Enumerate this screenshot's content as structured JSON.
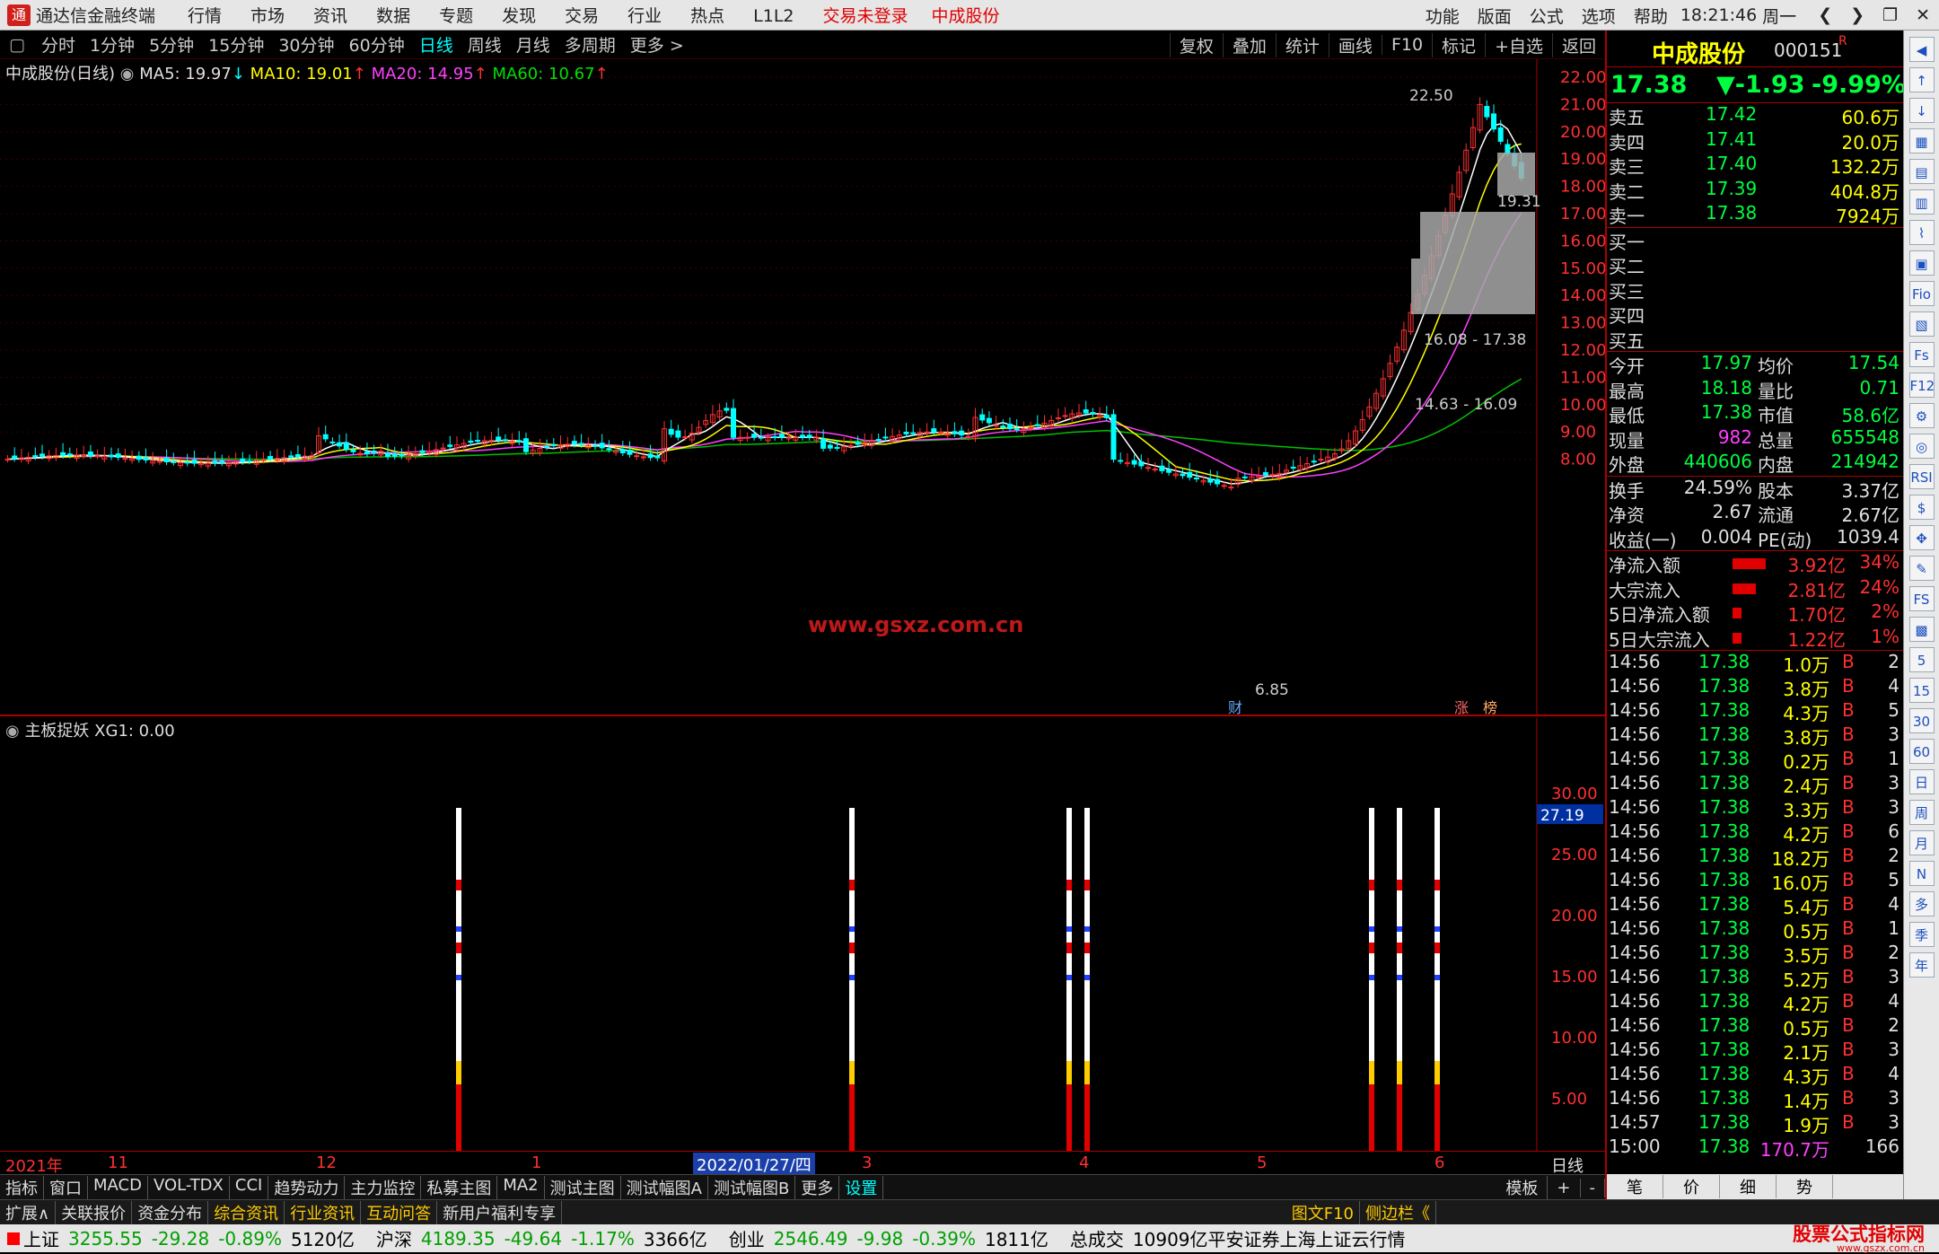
{
  "titlebar": {
    "app_name": "通达信金融终端",
    "menus": [
      "行情",
      "市场",
      "资讯",
      "数据",
      "专题",
      "发现",
      "交易",
      "行业",
      "热点",
      "L1L2"
    ],
    "trade_status": "交易未登录",
    "stock_name": "中成股份",
    "right_menus": [
      "功能",
      "版面",
      "公式",
      "选项",
      "帮助"
    ],
    "time": "18:21:46",
    "weekday": "周一"
  },
  "periods": [
    "分时",
    "1分钟",
    "5分钟",
    "15分钟",
    "30分钟",
    "60分钟",
    "日线",
    "周线",
    "月线",
    "多周期",
    "更多 >"
  ],
  "active_period": "日线",
  "chart_tools": [
    "复权",
    "叠加",
    "统计",
    "画线",
    "F10",
    "标记",
    "+自选",
    "返回"
  ],
  "main_chart": {
    "title": "中成股份(日线)",
    "ma5": "MA5: 19.97",
    "ma10": "MA10: 19.01",
    "ma20": "MA20: 14.95",
    "ma60": "MA60: 10.67",
    "high_label": "22.50",
    "low_label": "6.85",
    "last_label": "19.31",
    "gap1_label": "16.08 - 17.38",
    "gap2_label": "14.63 - 16.09",
    "watermark": "www.gsxz.com.cn",
    "badge_cai": "财",
    "badge_zhang": "涨",
    "badge_bang": "榜",
    "y_ticks": [
      "22.00",
      "21.00",
      "20.00",
      "19.00",
      "18.00",
      "17.00",
      "16.00",
      "15.00",
      "14.00",
      "13.00",
      "12.00",
      "11.00",
      "10.00",
      "9.00",
      "8.00"
    ]
  },
  "sub_chart": {
    "title": "主板捉妖 XG1: 0.00",
    "y_ticks": [
      "30.00",
      "25.00",
      "20.00",
      "15.00",
      "10.00",
      "5.00"
    ],
    "cursor_value": "27.19"
  },
  "x_axis": {
    "labels": [
      "2021年",
      "11",
      "12",
      "1",
      "2022/01/27/四",
      "3",
      "4",
      "5",
      "6"
    ],
    "period_label": "日线"
  },
  "tabs": [
    "指标",
    "窗口",
    "MACD",
    "VOL-TDX",
    "CCI",
    "趋势动力",
    "主力监控",
    "私募主图",
    "MA2",
    "测试主图",
    "测试幅图A",
    "测试幅图B",
    "更多",
    "设置"
  ],
  "tabs_right": [
    "模板",
    "+",
    "-"
  ],
  "links": [
    "扩展∧",
    "关联报价",
    "资金分布",
    "综合资讯",
    "行业资讯",
    "互动问答",
    "新用户福利专享"
  ],
  "links_right": [
    "图文F10",
    "侧边栏《",
    "笔",
    "价",
    "细",
    "势"
  ],
  "quote": {
    "name": "中成股份",
    "code": "000151",
    "flag": "R",
    "price": "17.38",
    "change": "▼-1.93",
    "change_pct": "-9.99%",
    "asks": [
      {
        "label": "卖五",
        "price": "17.42",
        "vol": "60.6万"
      },
      {
        "label": "卖四",
        "price": "17.41",
        "vol": "20.0万"
      },
      {
        "label": "卖三",
        "price": "17.40",
        "vol": "132.2万"
      },
      {
        "label": "卖二",
        "price": "17.39",
        "vol": "404.8万"
      },
      {
        "label": "卖一",
        "price": "17.38",
        "vol": "7924万"
      }
    ],
    "bids": [
      "买一",
      "买二",
      "买三",
      "买四",
      "买五"
    ],
    "stats": [
      {
        "k1": "今开",
        "v1": "17.97",
        "k2": "均价",
        "v2": "17.54"
      },
      {
        "k1": "最高",
        "v1": "18.18",
        "k2": "量比",
        "v2": "0.71"
      },
      {
        "k1": "最低",
        "v1": "17.38",
        "k2": "市值",
        "v2": "58.6亿"
      },
      {
        "k1": "现量",
        "v1": "982",
        "k2": "总量",
        "v2": "655548"
      },
      {
        "k1": "外盘",
        "v1": "440606",
        "k2": "内盘",
        "v2": "214942"
      }
    ],
    "stats2": [
      {
        "k1": "换手",
        "v1": "24.59%",
        "k2": "股本",
        "v2": "3.37亿"
      },
      {
        "k1": "净资",
        "v1": "2.67",
        "k2": "流通",
        "v2": "2.67亿"
      },
      {
        "k1": "收益(一)",
        "v1": "0.004",
        "k2": "PE(动)",
        "v2": "1039.4"
      }
    ],
    "flows": [
      {
        "label": "净流入额",
        "value": "3.92亿",
        "pct": "34%",
        "bar": 0.34
      },
      {
        "label": "大宗流入",
        "value": "2.81亿",
        "pct": "24%",
        "bar": 0.24
      },
      {
        "label": "5日净流入额",
        "value": "1.70亿",
        "pct": "2%",
        "bar": 0.02
      },
      {
        "label": "5日大宗流入",
        "value": "1.22亿",
        "pct": "1%",
        "bar": 0.01
      }
    ],
    "ticks": [
      {
        "t": "14:56",
        "p": "17.38",
        "v": "1.0万",
        "d": "B",
        "n": "2"
      },
      {
        "t": "14:56",
        "p": "17.38",
        "v": "3.8万",
        "d": "B",
        "n": "4"
      },
      {
        "t": "14:56",
        "p": "17.38",
        "v": "4.3万",
        "d": "B",
        "n": "5"
      },
      {
        "t": "14:56",
        "p": "17.38",
        "v": "3.8万",
        "d": "B",
        "n": "3"
      },
      {
        "t": "14:56",
        "p": "17.38",
        "v": "0.2万",
        "d": "B",
        "n": "1"
      },
      {
        "t": "14:56",
        "p": "17.38",
        "v": "2.4万",
        "d": "B",
        "n": "3"
      },
      {
        "t": "14:56",
        "p": "17.38",
        "v": "3.3万",
        "d": "B",
        "n": "3"
      },
      {
        "t": "14:56",
        "p": "17.38",
        "v": "4.2万",
        "d": "B",
        "n": "6"
      },
      {
        "t": "14:56",
        "p": "17.38",
        "v": "18.2万",
        "d": "B",
        "n": "2"
      },
      {
        "t": "14:56",
        "p": "17.38",
        "v": "16.0万",
        "d": "B",
        "n": "5"
      },
      {
        "t": "14:56",
        "p": "17.38",
        "v": "5.4万",
        "d": "B",
        "n": "4"
      },
      {
        "t": "14:56",
        "p": "17.38",
        "v": "0.5万",
        "d": "B",
        "n": "1"
      },
      {
        "t": "14:56",
        "p": "17.38",
        "v": "3.5万",
        "d": "B",
        "n": "2"
      },
      {
        "t": "14:56",
        "p": "17.38",
        "v": "5.2万",
        "d": "B",
        "n": "3"
      },
      {
        "t": "14:56",
        "p": "17.38",
        "v": "4.2万",
        "d": "B",
        "n": "4"
      },
      {
        "t": "14:56",
        "p": "17.38",
        "v": "0.5万",
        "d": "B",
        "n": "2"
      },
      {
        "t": "14:56",
        "p": "17.38",
        "v": "2.1万",
        "d": "B",
        "n": "3"
      },
      {
        "t": "14:56",
        "p": "17.38",
        "v": "4.3万",
        "d": "B",
        "n": "4"
      },
      {
        "t": "14:56",
        "p": "17.38",
        "v": "1.4万",
        "d": "B",
        "n": "3"
      },
      {
        "t": "14:57",
        "p": "17.38",
        "v": "1.9万",
        "d": "B",
        "n": "3"
      },
      {
        "t": "15:00",
        "p": "17.38",
        "v": "170.7万",
        "d": "",
        "n": "166"
      }
    ]
  },
  "side_icons": [
    "◀",
    "↑",
    "↓",
    "▦",
    "▤",
    "▥",
    "⌇",
    "▣",
    "Fio",
    "▧",
    "Fs",
    "F12",
    "⚙",
    "◎",
    "RSI",
    "$",
    "✥",
    "✎",
    "FS",
    "▩",
    "5",
    "15",
    "30",
    "60",
    "日",
    "周",
    "月",
    "N",
    "多",
    "季",
    "年"
  ],
  "status": {
    "idx1_name": "上证",
    "idx1_val": "3255.55",
    "idx1_chg": "-29.28",
    "idx1_pct": "-0.89%",
    "idx1_amt": "5120亿",
    "idx2_name": "沪深",
    "idx2_val": "4189.35",
    "idx2_chg": "-49.64",
    "idx2_pct": "-1.17%",
    "idx2_amt": "3366亿",
    "idx3_name": "创业",
    "idx3_val": "2546.49",
    "idx3_chg": "-9.98",
    "idx3_pct": "-0.39%",
    "idx3_amt": "1811亿",
    "total_label": "总成交",
    "total_val": "10909亿",
    "broker": "平安证券上海上证云行情",
    "brand": "股票公式指标网",
    "brand_url": "www.gszx.com.cn"
  },
  "colors": {
    "up": "#ff3030",
    "down": "#00ff40",
    "ma5": "#ffffff",
    "ma10": "#ffff00",
    "ma20": "#ff40ff",
    "ma60": "#00c000",
    "box": "#a0a0a0"
  }
}
